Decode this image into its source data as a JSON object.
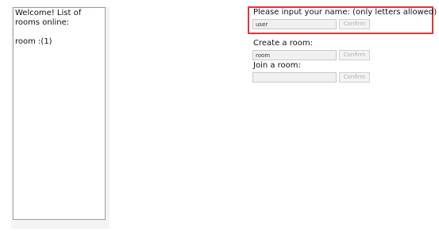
{
  "sidebar": {
    "welcome_text": "Welcome! List of rooms online:",
    "rooms": [
      {
        "label": "room :(1)"
      }
    ]
  },
  "name_section": {
    "label": "Please input your name: (only letters allowed)",
    "input_value": "user",
    "button_label": "Confirm"
  },
  "create_section": {
    "label": "Create a room:",
    "input_value": "room",
    "button_label": "Confirm"
  },
  "join_section": {
    "label": "Join a room:",
    "input_value": "",
    "button_label": "Confirm"
  }
}
